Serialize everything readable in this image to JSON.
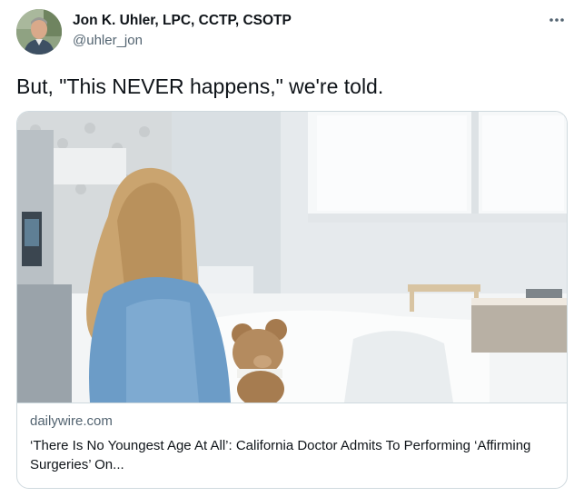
{
  "author": {
    "display_name": "Jon K. Uhler, LPC, CCTP, CSOTP",
    "handle": "@uhler_jon",
    "avatar": "avatar-photo"
  },
  "tweet": {
    "text": "But, \"This NEVER happens,\" we're told."
  },
  "menu": {
    "icon": "more-horizontal-icon"
  },
  "card": {
    "image": "hospital-child-teddy-bear-photo",
    "domain": "dailywire.com",
    "title": "‘There Is No Youngest Age At All’: California Doctor Admits To Performing ‘Affirming Surgeries’ On..."
  },
  "colors": {
    "text_primary": "#0f1419",
    "text_secondary": "#536471",
    "border": "#cfd9de"
  }
}
